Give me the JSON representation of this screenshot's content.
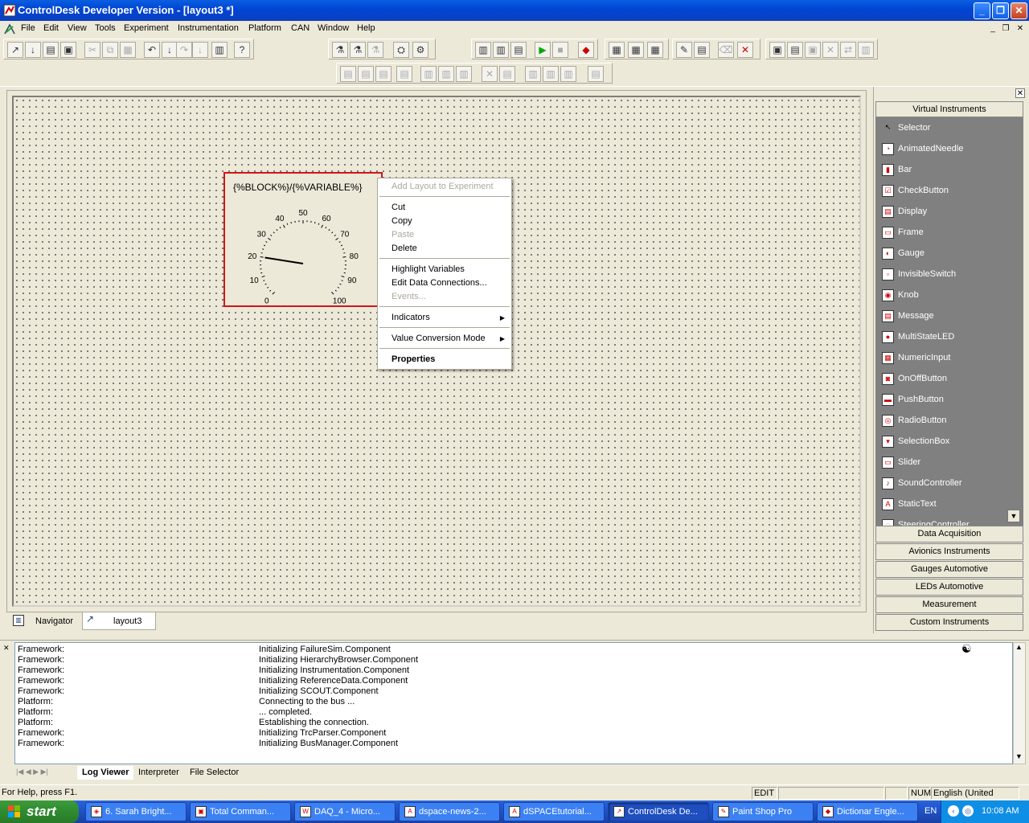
{
  "window": {
    "title": "ControlDesk Developer Version - [layout3 *]",
    "minimize": "_",
    "maximize": "❐",
    "close": "✕"
  },
  "menu": {
    "items": [
      "File",
      "Edit",
      "View",
      "Tools",
      "Experiment",
      "Instrumentation",
      "Platform",
      "CAN",
      "Window",
      "Help"
    ],
    "mdi_minimize": "_",
    "mdi_restore": "❐",
    "mdi_close": "✕"
  },
  "toolbar": {
    "icons": [
      "new-layout-icon",
      "open-icon",
      "save-icon",
      "cut-icon",
      "copy-icon",
      "paste-icon",
      "undo-icon",
      "redo-icon",
      "properties-icon",
      "help-icon",
      "experiment-icon",
      "start-icon",
      "stop-icon",
      "instrument-icon",
      "close-icon"
    ],
    "start_glyph": "▶",
    "stop_glyph": "■"
  },
  "instrument": {
    "caption": "{%BLOCK%}/{%VARIABLE%}",
    "ticks": [
      "0",
      "10",
      "20",
      "30",
      "40",
      "50",
      "60",
      "70",
      "80",
      "90",
      "100"
    ],
    "value": 20
  },
  "context_menu": {
    "add_layout": "Add Layout to Experiment",
    "cut": "Cut",
    "copy": "Copy",
    "paste": "Paste",
    "delete": "Delete",
    "highlight": "Highlight Variables",
    "edit_connections": "Edit Data Connections...",
    "events": "Events...",
    "indicators": "Indicators",
    "value_conversion": "Value Conversion Mode",
    "properties": "Properties"
  },
  "doc_tabs": {
    "navigator": "Navigator",
    "layout": "layout3"
  },
  "vi_panel": {
    "header": "Virtual Instruments",
    "items": [
      "Selector",
      "AnimatedNeedle",
      "Bar",
      "CheckButton",
      "Display",
      "Frame",
      "Gauge",
      "InvisibleSwitch",
      "Knob",
      "Message",
      "MultiStateLED",
      "NumericInput",
      "OnOffButton",
      "PushButton",
      "RadioButton",
      "SelectionBox",
      "Slider",
      "SoundController",
      "StaticText",
      "SteeringController"
    ],
    "groups": [
      "Data Acquisition",
      "Avionics Instruments",
      "Gauges Automotive",
      "LEDs Automotive",
      "Measurement",
      "Custom Instruments"
    ]
  },
  "log": {
    "rows": [
      {
        "src": "Framework:",
        "msg": "Initializing FailureSim.Component"
      },
      {
        "src": "Framework:",
        "msg": "Initializing HierarchyBrowser.Component"
      },
      {
        "src": "Framework:",
        "msg": "Initializing Instrumentation.Component"
      },
      {
        "src": "Framework:",
        "msg": "Initializing ReferenceData.Component"
      },
      {
        "src": "Framework:",
        "msg": "Initializing SCOUT.Component"
      },
      {
        "src": "Platform:",
        "msg": "Connecting to the bus ..."
      },
      {
        "src": "Platform:",
        "msg": "... completed."
      },
      {
        "src": "Platform:",
        "msg": "Establishing the connection."
      },
      {
        "src": "Framework:",
        "msg": "Initializing TrcParser.Component"
      },
      {
        "src": "Framework:",
        "msg": "Initializing BusManager.Component"
      }
    ],
    "tabs": [
      "Log Viewer",
      "Interpreter",
      "File Selector"
    ]
  },
  "status": {
    "help": "For Help, press F1.",
    "mode": "EDIT",
    "num": "NUM",
    "language": "English (United States)"
  },
  "taskbar": {
    "start": "start",
    "tasks": [
      "6. Sarah Bright...",
      "Total Comman...",
      "DAQ_4 - Micro...",
      "dspace-news-2...",
      "dSPACEtutorial...",
      "ControlDesk De...",
      "Paint Shop Pro",
      "Dictionar Engle..."
    ],
    "lang": "EN",
    "clock": "10:08 AM"
  }
}
